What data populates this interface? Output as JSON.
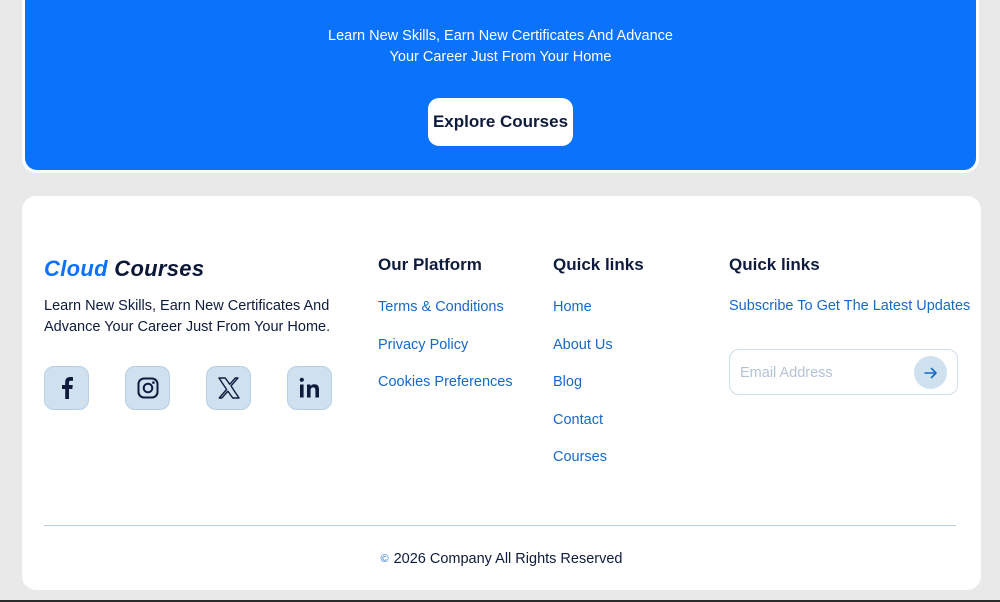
{
  "hero": {
    "subtitle_line1": "Learn New Skills, Earn New Certificates And Advance",
    "subtitle_line2": "Your Career Just From Your Home",
    "cta_label": "Explore Courses"
  },
  "footer": {
    "logo": {
      "part1": "Cloud",
      "part2": "Courses"
    },
    "about_text": "Learn New Skills, Earn New Certificates And Advance Your Career Just From Your Home.",
    "socials": [
      {
        "icon": "facebook-icon"
      },
      {
        "icon": "instagram-icon"
      },
      {
        "icon": "x-twitter-icon"
      },
      {
        "icon": "linkedin-icon"
      }
    ],
    "platform": {
      "heading": "Our Platform",
      "links": [
        "Terms & Conditions",
        "Privacy Policy",
        "Cookies Preferences"
      ]
    },
    "quick_links": {
      "heading": "Quick links",
      "links": [
        "Home",
        "About Us",
        "Blog",
        "Contact",
        "Courses"
      ]
    },
    "subscribe": {
      "heading": "Quick links",
      "text": "Subscribe To Get The Latest Updates",
      "placeholder": "Email Address"
    },
    "copyright": {
      "symbol": "©",
      "text": "2026 Company All Rights Reserved"
    }
  },
  "colors": {
    "brand_blue": "#0a72fb",
    "link_blue": "#1669c9",
    "dark_text": "#0f1b3d",
    "icon_bg": "#cfe0ef"
  }
}
